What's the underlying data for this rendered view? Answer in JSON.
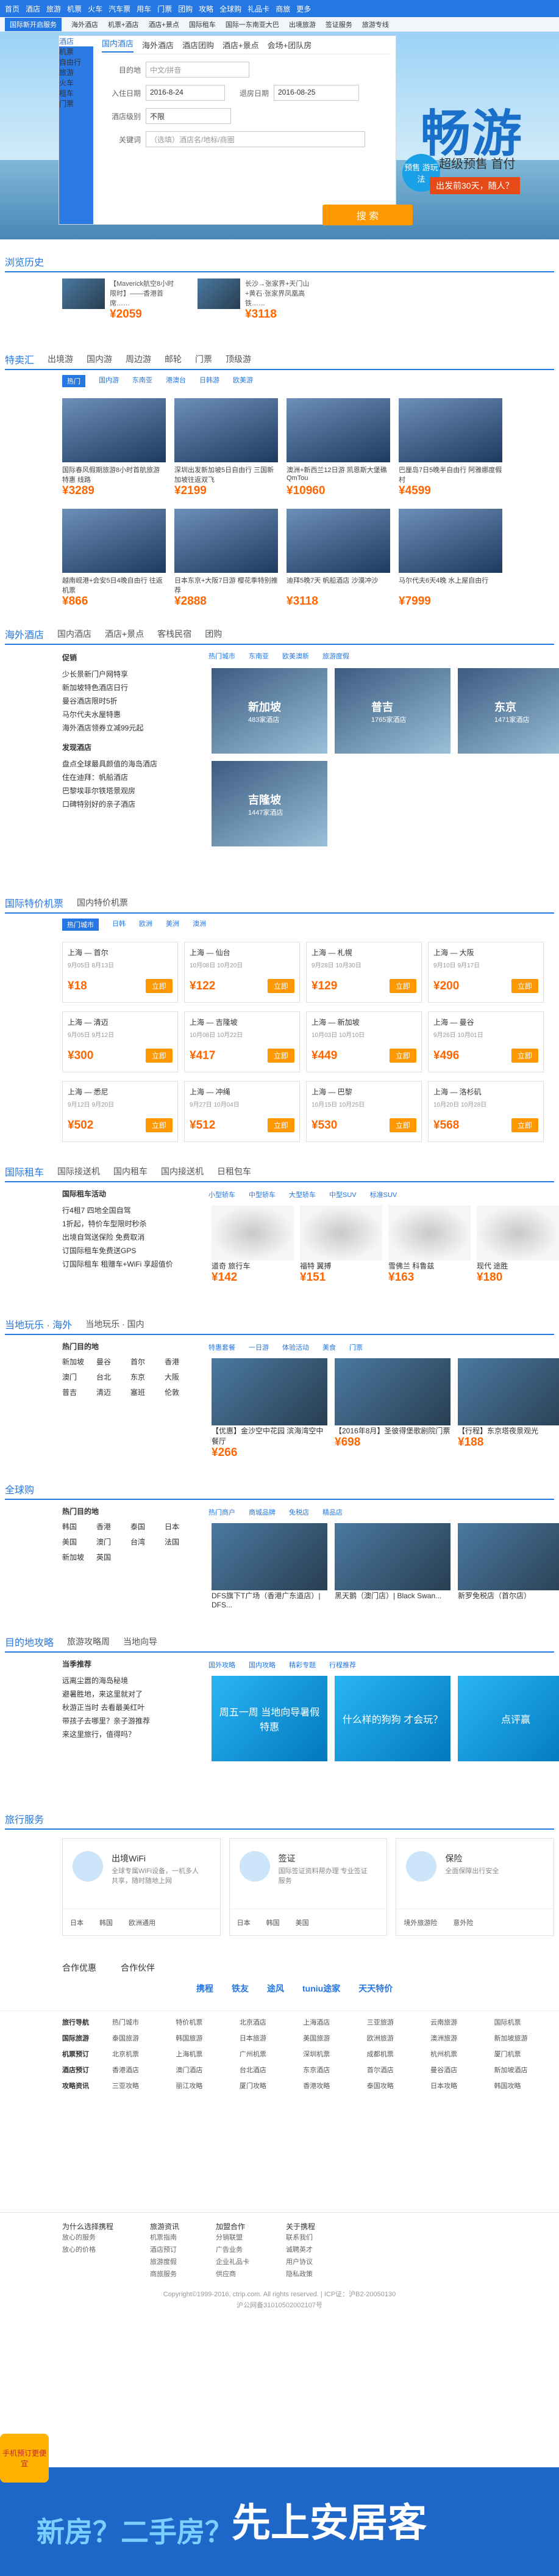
{
  "nav": {
    "items": [
      "首页",
      "酒店",
      "旅游",
      "机票",
      "火车",
      "汽车票",
      "用车",
      "门票",
      "团购",
      "攻略",
      "全球购",
      "礼品卡",
      "商旅",
      "更多"
    ]
  },
  "subbar": {
    "items": [
      "国际新开启服务",
      "海外酒店",
      "机票+酒店",
      "酒店+景点",
      "国际租车",
      "国际一东南亚大巴",
      "出境旅游",
      "签证服务",
      "旅游专线"
    ]
  },
  "hero": {
    "big": "畅游",
    "promo": "超级预售 首付",
    "promo2": "出发前30天，随人？",
    "badge": "预售 游玩法"
  },
  "search": {
    "tabs": [
      "酒店",
      "机票",
      "自由行",
      "旅游",
      "火车",
      "租车",
      "门票"
    ],
    "form_tabs": [
      "国内酒店",
      "海外酒店",
      "酒店团购",
      "酒店+景点",
      "会场+团队房"
    ],
    "city_label": "目的地",
    "city_placeholder": "中文/拼音",
    "checkin_label": "入住日期",
    "checkin_value": "2016-8-24",
    "checkout_label": "退房日期",
    "checkout_value": "2016-08-25",
    "star_label": "酒店级别",
    "star_value": "不限",
    "keyword_label": "关键词",
    "keyword_placeholder": "（选填）酒店名/地标/商圈",
    "button": "搜 索"
  },
  "history": {
    "title": "浏览历史",
    "cards": [
      {
        "text": "【Maverick航空8小时限时】——香港首席……",
        "price": "¥2059"
      },
      {
        "text": "长沙→张家界+天门山+黄石·张家界凤凰高铁……",
        "price": "¥3118"
      }
    ]
  },
  "deals": {
    "tabs": [
      "特卖汇",
      "出境游",
      "国内游",
      "周边游",
      "邮轮",
      "门票",
      "顶级游"
    ],
    "filters": [
      "热门",
      "国内游",
      "东南亚",
      "港澳台",
      "日韩游",
      "欧美游"
    ],
    "tiles": [
      {
        "cap": "国际春风假期旅游8小时首航旅游特惠 线路",
        "price": "¥3289"
      },
      {
        "cap": "深圳出发新加坡5日自由行 三国新加坡往返双飞",
        "price": "¥2199"
      },
      {
        "cap": "澳洲+新西兰12日游 凯恩斯大堡礁QmTou",
        "price": "¥10960"
      },
      {
        "cap": "巴厘岛7日5晚半自由行 阿雅娜度假村",
        "price": "¥4599"
      },
      {
        "cap": "越南岘港+会安5日4晚自由行 往返机票",
        "price": "¥866"
      },
      {
        "cap": "日本东京+大阪7日游 樱花季特别推荐",
        "price": "¥2888"
      },
      {
        "cap": "迪拜5晚7天 帆船酒店 沙漠冲沙",
        "price": "¥3118"
      },
      {
        "cap": "马尔代夫6天4晚 水上屋自由行",
        "price": "¥7999"
      }
    ]
  },
  "overseas": {
    "tabs": [
      "海外酒店",
      "国内酒店",
      "酒店+景点",
      "客栈民宿",
      "团购"
    ],
    "left_title": "促销",
    "left_items": [
      "少长景新门户网特享",
      "新加坡特色酒店日行",
      "曼谷酒店限时5折",
      "马尔代夫水屋特惠",
      "海外酒店领券立减99元起"
    ],
    "left_title2": "发现酒店",
    "left_items2": [
      "盘点全球最具颜值的海岛酒店",
      "住在迪拜：帆船酒店",
      "巴黎埃菲尔铁塔景观房",
      "口碑特别好的亲子酒店"
    ],
    "filters": [
      "热门城市",
      "东南亚",
      "欧美澳新",
      "旅游度假"
    ],
    "cities": [
      {
        "name": "新加坡",
        "sub": "483家酒店"
      },
      {
        "name": "普吉",
        "sub": "1765家酒店"
      },
      {
        "name": "东京",
        "sub": "1471家酒店"
      },
      {
        "name": "吉隆坡",
        "sub": "1447家酒店"
      }
    ]
  },
  "flights": {
    "tabs": [
      "国际特价机票",
      "国内特价机票"
    ],
    "filters": [
      "热门城市",
      "日韩",
      "欧洲",
      "美洲",
      "澳洲"
    ],
    "cards": [
      {
        "route": "上海 — 首尔",
        "date": "9月05日  8月13日",
        "price": "¥18"
      },
      {
        "route": "上海 — 仙台",
        "date": "10月08日 10月20日",
        "price": "¥122"
      },
      {
        "route": "上海 — 札幌",
        "date": "9月28日 10月30日",
        "price": "¥129"
      },
      {
        "route": "上海 — 大阪",
        "date": "9月10日 9月17日",
        "price": "¥200"
      },
      {
        "route": "上海 — 清迈",
        "date": "9月05日 9月12日",
        "price": "¥300"
      },
      {
        "route": "上海 — 吉隆坡",
        "date": "10月08日 10月22日",
        "price": "¥417"
      },
      {
        "route": "上海 — 新加坡",
        "date": "10月03日 10月10日",
        "price": "¥449"
      },
      {
        "route": "上海 — 曼谷",
        "date": "9月26日 10月01日",
        "price": "¥496"
      },
      {
        "route": "上海 — 悉尼",
        "date": "9月12日 9月20日",
        "price": "¥502"
      },
      {
        "route": "上海 — 冲绳",
        "date": "9月27日 10月04日",
        "price": "¥512"
      },
      {
        "route": "上海 — 巴黎",
        "date": "10月15日 10月25日",
        "price": "¥530"
      },
      {
        "route": "上海 — 洛杉矶",
        "date": "10月20日 10月28日",
        "price": "¥568"
      }
    ],
    "book": "立即"
  },
  "cars": {
    "tabs": [
      "国际租车",
      "国际接送机",
      "国内租车",
      "国内接送机",
      "日租包车"
    ],
    "left_title": "国际租车活动",
    "left_items": [
      "行4租7 四地全国自驾",
      "1折起，特价车型限时秒杀",
      "出境自驾送保险 免费取消",
      "订国际租车免费送GPS",
      "订国际租车 租赠车+WiFi 享超值价"
    ],
    "filters": [
      "小型轿车",
      "中型轿车",
      "大型轿车",
      "中型SUV",
      "标准SUV"
    ],
    "cars": [
      {
        "name": "道奇 旅行车",
        "price": "¥142"
      },
      {
        "name": "福特 翼搏",
        "price": "¥151"
      },
      {
        "name": "雪佛兰 科鲁兹",
        "price": "¥163"
      },
      {
        "name": "现代 途胜",
        "price": "¥180"
      }
    ]
  },
  "local": {
    "tabs": [
      "当地玩乐 · 海外",
      "当地玩乐 · 国内"
    ],
    "left_title": "热门目的地",
    "dests": [
      "新加坡",
      "曼谷",
      "首尔",
      "香港",
      "澳门",
      "台北",
      "东京",
      "大阪",
      "普吉",
      "清迈",
      "塞班",
      "伦敦"
    ],
    "filters": [
      "特惠套餐",
      "一日游",
      "体验活动",
      "美食",
      "门票"
    ],
    "items": [
      {
        "cap": "【优惠】金沙空中花园  滨海湾空中餐厅",
        "price": "¥266"
      },
      {
        "cap": "【2016年8月】圣彼得堡歌剧院门票",
        "price": "¥698"
      },
      {
        "cap": "【行程】东京塔夜景观光",
        "price": "¥188"
      }
    ]
  },
  "shopping": {
    "title": "全球购",
    "dest_title": "热门目的地",
    "dests": [
      "韩国",
      "香港",
      "泰国",
      "日本",
      "美国",
      "澳门",
      "台湾",
      "法国",
      "新加坡",
      "英国"
    ],
    "filters": [
      "热门商户",
      "商城品牌",
      "免税店",
      "精品店"
    ],
    "items": [
      {
        "cap": "DFS旗下T广场（香港广东道店）| DFS..."
      },
      {
        "cap": "黑天鹅（澳门店）| Black Swan..."
      },
      {
        "cap": "新罗免税店（首尔店）"
      }
    ]
  },
  "guides": {
    "tabs": [
      "目的地攻略",
      "旅游攻略周",
      "当地向导"
    ],
    "left_title": "当季推荐",
    "left_items": [
      "远离尘嚣的海岛秘境",
      "避暑胜地，来这里就对了",
      "秋游正当时 去看最美红叶",
      "带孩子去哪里？亲子游推荐",
      "来这里旅行，值得吗？"
    ],
    "filters": [
      "国外攻略",
      "国内攻略",
      "精彩专题",
      "行程推荐"
    ],
    "items": [
      {
        "cap": "周五一周 当地向导暑假特惠"
      },
      {
        "cap": "什么样的狗狗 才会玩？"
      },
      {
        "cap": "点评赢"
      }
    ]
  },
  "services": {
    "title": "旅行服务",
    "cards": [
      {
        "title": "出境WiFi",
        "desc": "全球专属WiFi设备，一机多人共享，随时随地上网",
        "foot": [
          "日本",
          "韩国",
          "欧洲通用"
        ]
      },
      {
        "title": "签证",
        "desc": "国际签证资料帮办理 专业签证服务",
        "foot": [
          "日本",
          "韩国",
          "美国"
        ]
      },
      {
        "title": "保险",
        "desc": "全面保障出行安全",
        "foot": [
          "境外旅游险",
          "意外险"
        ]
      }
    ]
  },
  "partners": {
    "title1": "合作优惠",
    "title2": "合作伙伴",
    "logos": [
      "携程",
      "铁友",
      "途风",
      "tuniu途家",
      "天天特价"
    ]
  },
  "links": {
    "rows": [
      {
        "hd": "旅行导航",
        "items": [
          "热门城市",
          "特价机票",
          "北京酒店",
          "上海酒店",
          "三亚旅游",
          "云南旅游",
          "国际机票"
        ]
      },
      {
        "hd": "国际旅游",
        "items": [
          "泰国旅游",
          "韩国旅游",
          "日本旅游",
          "美国旅游",
          "欧洲旅游",
          "澳洲旅游",
          "新加坡旅游"
        ]
      },
      {
        "hd": "机票预订",
        "items": [
          "北京机票",
          "上海机票",
          "广州机票",
          "深圳机票",
          "成都机票",
          "杭州机票",
          "厦门机票"
        ]
      },
      {
        "hd": "酒店预订",
        "items": [
          "香港酒店",
          "澳门酒店",
          "台北酒店",
          "东京酒店",
          "首尔酒店",
          "曼谷酒店",
          "新加坡酒店"
        ]
      },
      {
        "hd": "攻略资讯",
        "items": [
          "三亚攻略",
          "丽江攻略",
          "厦门攻略",
          "香港攻略",
          "泰国攻略",
          "日本攻略",
          "韩国攻略"
        ]
      }
    ]
  },
  "footer": {
    "cols": [
      {
        "hd": "为什么选择携程",
        "items": [
          "放心的服务",
          "放心的价格"
        ]
      },
      {
        "hd": "旅游资讯",
        "items": [
          "机票指南",
          "酒店预订",
          "旅游度假",
          "商旅服务"
        ]
      },
      {
        "hd": "加盟合作",
        "items": [
          "分销联盟",
          "广告业务",
          "企业礼品卡",
          "供应商"
        ]
      },
      {
        "hd": "关于携程",
        "items": [
          "联系我们",
          "诚聘英才",
          "用户协议",
          "隐私政策"
        ]
      }
    ],
    "copyright": "Copyright©1999-2016, ctrip.com. All rights reserved. | ICP证：沪B2-20050130",
    "beian": "沪公网备31010502002107号"
  },
  "float": {
    "slogan": "先上安居客",
    "left": "新房？二手房？",
    "corner": "手机预订更便宜"
  }
}
